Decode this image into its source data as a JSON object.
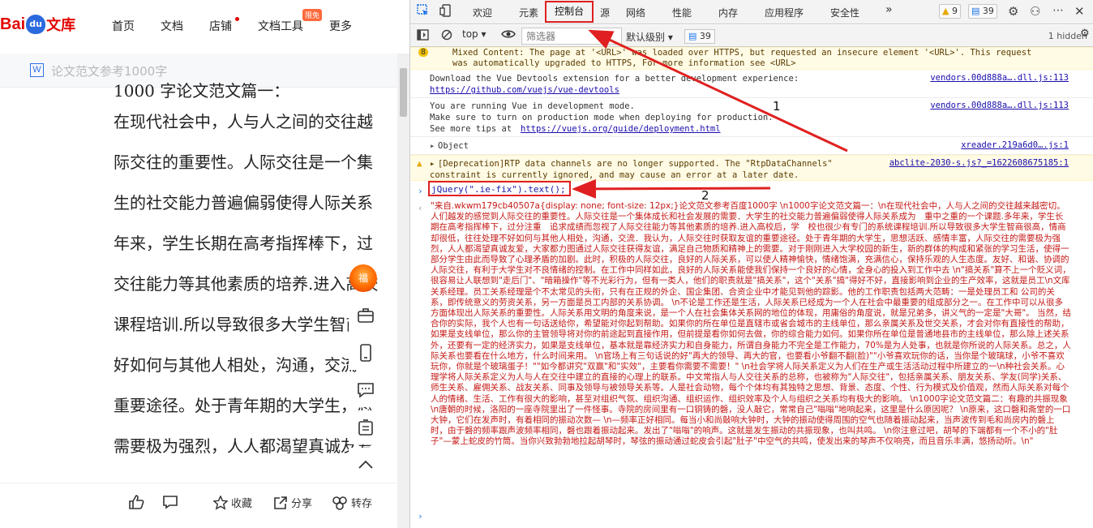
{
  "wenku": {
    "logo_bai": "Bai",
    "logo_du": "du",
    "logo_wenku": "文库",
    "nav": [
      "首页",
      "文档",
      "店铺",
      "文档工具",
      "更多"
    ],
    "nav_badge": "限免",
    "doc_title": "论文范文参考1000字",
    "doc_icon": "W",
    "body_lines": [
      "1000 字论文范文篇一：",
      "在现代社会中，人与人之间的交往越",
      "际交往的重要性。人际交往是一个集",
      "生的社交能力普遍偏弱使得人际关系",
      "年来，学生长期在高考指挥棒下，过",
      "交往能力等其他素质的培养.进入高校",
      "课程培训.所以导致很多大学生智商很",
      "好如何与其他人相处，沟通，交流",
      "重要途径。处于青年期的大学生，思",
      "需要极为强烈，人人都渴望真诚友爱"
    ],
    "bottom": {
      "like": "",
      "comment": "",
      "fav": "收藏",
      "share": "分享",
      "repost": "转存"
    }
  },
  "devtools": {
    "tabs": [
      "欢迎",
      "元素",
      "控制台",
      "源",
      "网络",
      "性能",
      "内存",
      "应用程序",
      "安全性"
    ],
    "active_tab": "控制台",
    "warn_count": "9",
    "msg_count": "39",
    "context": "top",
    "filter_placeholder": "筛选器",
    "levels": "默认级别",
    "toolbar_badge": "39",
    "hidden": "1 hidden",
    "entries": {
      "mixed_1": "Mixed Content: The page at '<URL>' was loaded over HTTPS, but requested an insecure element '<URL>'. This request",
      "mixed_2": "was automatically upgraded to HTTPS, For more information see <URL>",
      "mixed_count": "8",
      "vue1_a": "Download the Vue Devtools extension for a better development experience:",
      "vue1_link": "https://github.com/vuejs/vue-devtools",
      "vue1_src": "vendors.00d888a….dll.js:113",
      "vue2_a": "You are running Vue in development mode.",
      "vue2_b": "Make sure to turn on production mode when deploying for production.",
      "vue2_c": "See more tips at ",
      "vue2_link": "https://vuejs.org/guide/deployment.html",
      "vue2_src": "vendors.00d888a….dll.js:113",
      "object": "Object",
      "object_src": "xreader.219a6d0….js:1",
      "depr_1": "[Deprecation]RTP data channels are no longer supported. The \"RtpDataChannels\"",
      "depr_2": "constraint is currently ignored, and may cause an error at a later date.",
      "depr_src": "abclite-2030-s.js?_=1622608675185:1",
      "command": "jQuery(\".ie-fix\").text();"
    },
    "result": "\"来自.wkwm179cb40507a{display: none; font-size: 12px;}论文范文参考百度1000字  \\n1000字论文范文篇一：\\n在现代社会中，人与人之间的交往越来越密切。人们越发的感觉到人际交往的重要性。人际交往是一个集体成长和社会发展的需要．大学生的社交能力普遍偏弱使得人际关系成为　重中之重的一个课题.多年来，学生长期在高考指挥棒下，过分注重　追求成绩而忽视了人际交往能力等其他素质的培养.进入高校后，学　校也很少有专门的系统课程培训.所以导致很多大学生智商很高，情商却很低，往往处理不好如何与其他人相处，沟通，交流．我认为，人际交往时获取友谊的重要途径。处于青年期的大学生，思想活跃、感情丰富，人际交往的需要极为强烈，人人都渴望真诚友爱，大家都力图通过人际交往获得友谊，满足自己物质和精神上的需要。对于刚刚进入大学校园的新生，新的群体的构成和紧张的学习生活，使得一部分学生由此而导致了心理矛盾的加剧。此时，积极的人际交往，良好的人际关系，可以使人精神愉快，情绪饱满，充满信心，保持乐观的人生态度。友好、和谐、协调的人际交往，有利于大学生对不良情绪的控制。在工作中同样如此，良好的人际关系能使我们保持一个良好的心情，全身心的投入到工作中去 \\n\"搞关系\"算不上一个贬义词，很容易让人联想到\"走后门\"、\"暗箱操作\"等不光彩行为，但有一类人，他们的职责就是\"搞关系\"，这个\"关系\"搞\"得好不好，直接影响到企业的生产效率，这就是员工\\n文库关系经理。员工关系经理是个不太常见的头衔，只有在正规的外企、国企集团、合资企业中才能见到他的踪影。他的工作职责包括两大范畴：一是处理员工和 公司的关系，即传统意义的劳资关系，另一方面是员工内部的关系协调。 \\n不论是工作还是生活，人际关系已经成为一个人在社会中最重要的组成部分之一。在工作中可以从很多方面体现出人际关系的重要性。人际关系用文明的角度来说，是一个人在社会集体关系网的地位的体现，用庸俗的角度说，就是兄弟多，讲义气的一定是\"大哥\"。 当然，结合你的实际，我个人也有一句话送给你，希望能对你起到帮助。如果你的所在单位是直辖市或省会城市的主线单位，那么亲属关系及世交关系，才会对你有直接性的帮助，如果是支线单位，那么你的主管领导将对你的前途起到直接作用，但前提是看你如何去做，你的综合能力如何。如果你所在单位是普通地县市的主线单位，那么除上述关系外，还要有一定的经济实力，如果是支线单位，基本就是靠经济实力和自身能力，所谓自身能力不完全是工作能力，70%是为人处事，也就是你所说的人际关系。总之，人际关系也要看在什么地方，什么时间来用。 \\n官场上有三句话说的好\"再大的领导、再大的官，也要看小爷翻不翻(脸)\"\"小爷喜欢玩你的话，当你是个玻璃球，小爷不喜欢玩你，你就是个玻璃蛋子！\"\"如今都讲究\"双赢\"和\"实效\"，主要看你需要不需要！\" \\n社会学将人际关系定义为人们在生产或生活活动过程中所建立的一\\n种社会关系。心理学将人际关系定义为人与人在交往中建立的直接的心理上的联系。中文常指人与人交往关系的总称，也被称为\"人际交往\"，包括亲属关系、朋友关系、学友(同学)关系、师生关系、雇佣关系、战友关系、同事及领导与被领导关系等。人是社会动物，每个个体均有其独特之思想、背景、态度、个性、行为模式及价值观，然而人际关系对每个人的情绪、生活、工作有很大的影响，甚至对组织气氛、组织沟通、组织运作、组织效率及个人与组织之关系均有极大的影响。 \\n1000字论文范文篇二：有趣的共振现象 \\n唐朝的时候，洛阳的一座寺院里出了一件怪事。寺院的房间里有一口铜铸的磬，没人敲它，常常自己\"嗡嗡\"地响起来，这里是什么原因呢？ \\n原来，这口磬和斋堂的一口大钟，它们在发声时，有着相同的振动次数— \\n—频率正好相同。每当小和尚敲响大钟时，大钟的振动使得周围的空气也随着振动起来，当声波传到毛和尚房内的磬上时，由于磬的频率跟声波频率相同，磬也跟着振动起来。发出了\"嗡嗡\"的响声。这就是发生振动的共振现象，也叫共鸣。 \\n你注意过吧，胡琴的下端都有一个不小的\"肚子\"—蒙上蛇皮的竹筒。当你兴致勃勃地拉起胡琴时，琴弦的振动通过蛇皮会引起\"肚子\"中空气的共鸣，使发出来的琴声不仅响亮，而且音乐丰满，悠扬动听。\\n\"",
    "annotations": [
      "1",
      "2"
    ]
  }
}
